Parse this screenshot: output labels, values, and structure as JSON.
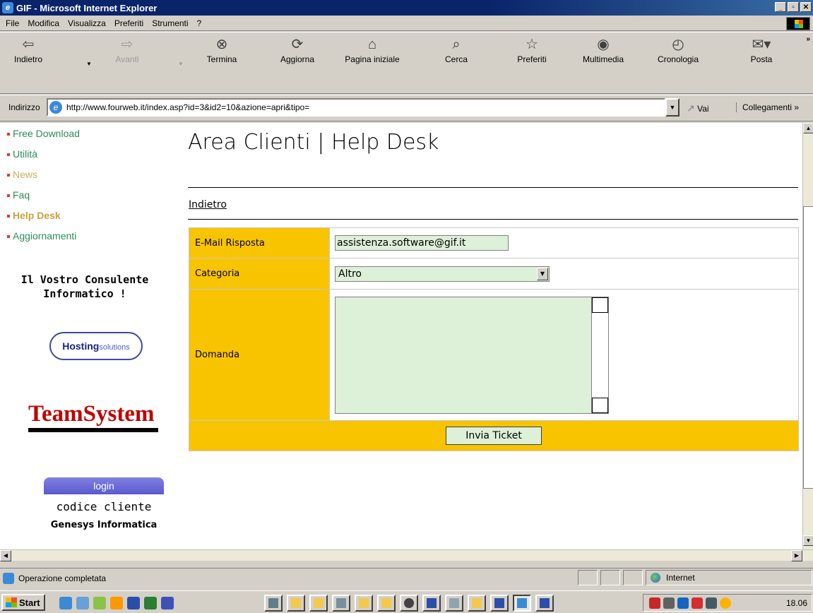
{
  "window": {
    "title": "GIF - Microsoft Internet Explorer",
    "controls": [
      "_",
      "▫",
      "✕"
    ]
  },
  "menu": [
    "File",
    "Modifica",
    "Visualizza",
    "Preferiti",
    "Strumenti",
    "?"
  ],
  "toolbar": {
    "back": "Indietro",
    "forward": "Avanti",
    "stop": "Termina",
    "refresh": "Aggiorna",
    "home": "Pagina iniziale",
    "search": "Cerca",
    "favorites": "Preferiti",
    "media": "Multimedia",
    "history": "Cronologia",
    "mail": "Posta"
  },
  "address": {
    "label": "Indirizzo",
    "url": "http://www.fourweb.it/index.asp?id=3&id2=10&azione=apri&tipo=",
    "go": "Vai",
    "links": "Collegamenti"
  },
  "nav": {
    "items": [
      {
        "label": "Free Download",
        "state": "normal"
      },
      {
        "label": "Utilità",
        "state": "normal"
      },
      {
        "label": "News",
        "state": "muted"
      },
      {
        "label": "Faq",
        "state": "normal"
      },
      {
        "label": "Help Desk",
        "state": "active"
      },
      {
        "label": "Aggiornamenti",
        "state": "normal"
      }
    ],
    "consulente_line1": "Il Vostro Consulente",
    "consulente_line2": "Informatico !",
    "hosting_logo_main": "Hosting",
    "hosting_logo_sub": "solutions",
    "teamsystem_logo": "TeamSystem",
    "login_label": "login",
    "codice_label": "codice cliente",
    "genesys_label": "Genesys Informatica"
  },
  "main": {
    "title": "Area Clienti | Help Desk",
    "back_link": "Indietro",
    "form": {
      "email_label": "E-Mail Risposta",
      "email_value": "assistenza.software@gif.it",
      "category_label": "Categoria",
      "category_value": "Altro",
      "question_label": "Domanda",
      "question_value": "",
      "submit_label": "Invia Ticket"
    }
  },
  "status": {
    "text": "Operazione completata",
    "zone": "Internet"
  },
  "taskbar": {
    "start": "Start",
    "clock": "18.06"
  },
  "colors": {
    "form_label_bg": "#f8c400",
    "input_bg": "#ddf0d8",
    "nav_link": "#2e8b57",
    "nav_active": "#c8a040"
  }
}
